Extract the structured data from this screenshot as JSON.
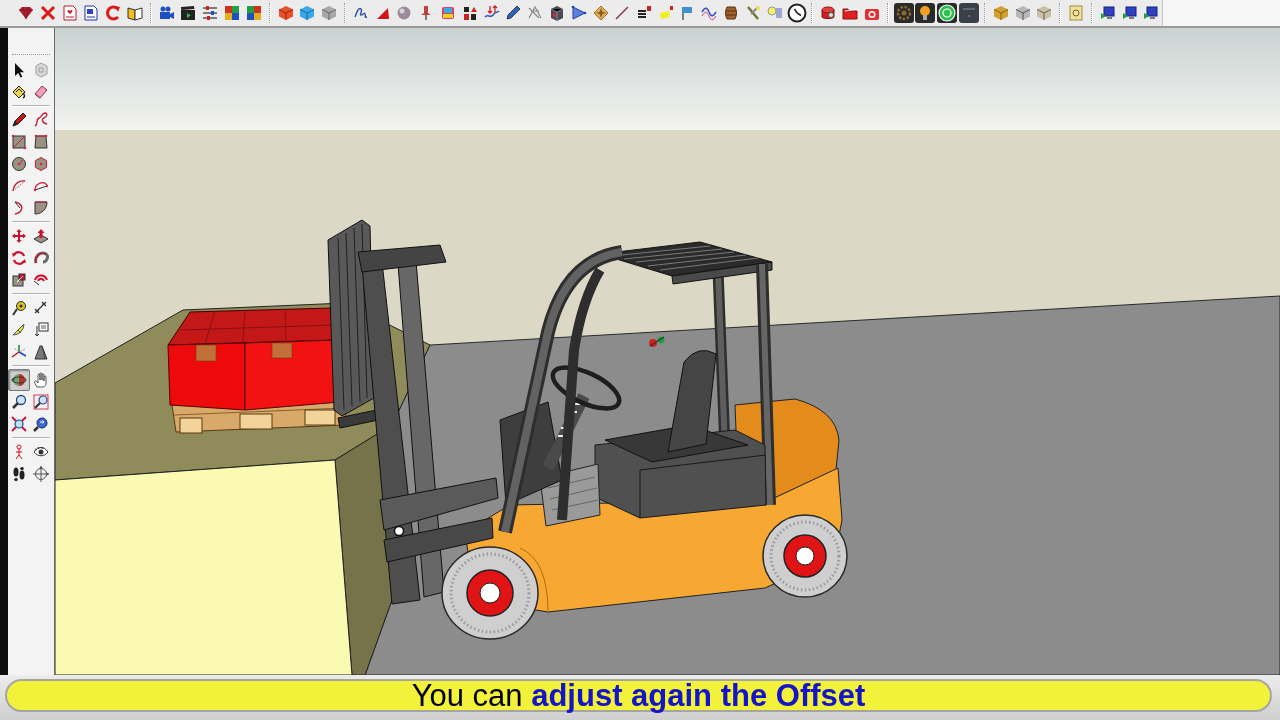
{
  "left_toolbar": {
    "groups": [
      {
        "tools": [
          {
            "kind": "select",
            "selected": false
          },
          {
            "kind": "component",
            "selected": false
          },
          {
            "kind": "paint",
            "selected": false
          },
          {
            "kind": "eraser",
            "selected": false
          }
        ]
      },
      {
        "tools": [
          {
            "kind": "line",
            "selected": false
          },
          {
            "kind": "freehand",
            "selected": false
          },
          {
            "kind": "rectangle",
            "selected": false
          },
          {
            "kind": "rotated",
            "selected": false
          },
          {
            "kind": "circle",
            "selected": false
          },
          {
            "kind": "polygon",
            "selected": false
          },
          {
            "kind": "arc",
            "selected": false
          },
          {
            "kind": "chordarc",
            "selected": false
          },
          {
            "kind": "halfarc",
            "selected": false
          },
          {
            "kind": "pie",
            "selected": false
          }
        ]
      },
      {
        "tools": [
          {
            "kind": "move",
            "selected": false
          },
          {
            "kind": "pushpull",
            "selected": false
          },
          {
            "kind": "rotate",
            "selected": false
          },
          {
            "kind": "followme",
            "selected": false
          },
          {
            "kind": "scale",
            "selected": false
          },
          {
            "kind": "offset",
            "selected": false
          }
        ]
      },
      {
        "tools": [
          {
            "kind": "tape",
            "selected": false
          },
          {
            "kind": "dimension",
            "selected": false
          },
          {
            "kind": "protractor",
            "selected": false
          },
          {
            "kind": "text",
            "selected": false
          },
          {
            "kind": "axes",
            "selected": false
          },
          {
            "kind": "solid",
            "selected": false
          }
        ]
      },
      {
        "tools": [
          {
            "kind": "orbit",
            "selected": true
          },
          {
            "kind": "pan",
            "selected": false
          },
          {
            "kind": "zoom",
            "selected": false
          },
          {
            "kind": "zoomwindow",
            "selected": false
          },
          {
            "kind": "extents",
            "selected": false
          },
          {
            "kind": "previous",
            "selected": false
          }
        ]
      },
      {
        "tools": [
          {
            "kind": "camera",
            "selected": false
          },
          {
            "kind": "look",
            "selected": false
          },
          {
            "kind": "walk",
            "selected": false
          },
          {
            "kind": "section",
            "selected": false
          }
        ]
      }
    ]
  },
  "caption": {
    "text": "You can **adjust again the Offset**"
  }
}
